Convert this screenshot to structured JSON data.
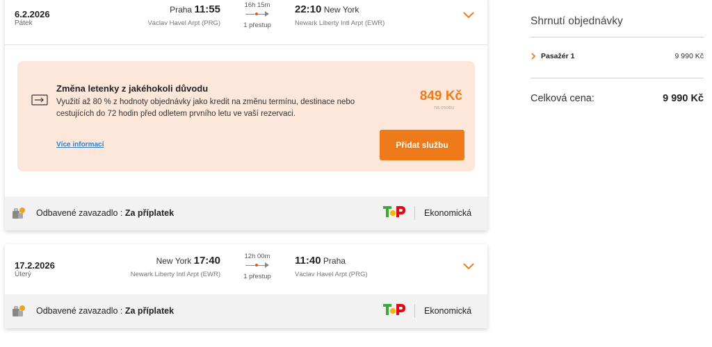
{
  "flights": [
    {
      "date": "6.2.2026",
      "weekday": "Pátek",
      "dep_city": "Praha",
      "dep_time": "11:55",
      "dep_airport": "Václav Havel Arpt (PRG)",
      "duration": "16h 15m",
      "stops": "1 přestup",
      "arr_time": "22:10",
      "arr_city": "New York",
      "arr_airport": "Newark Liberty Intl Arpt (EWR)",
      "baggage_label": "Odbavené zavazadlo :",
      "baggage_value": "Za příplatek",
      "cabin": "Ekonomická"
    },
    {
      "date": "17.2.2026",
      "weekday": "Úterý",
      "dep_city": "New York",
      "dep_time": "17:40",
      "dep_airport": "Newark Liberty Intl Arpt (EWR)",
      "duration": "12h 00m",
      "stops": "1 přestup",
      "arr_time": "11:40",
      "arr_city": "Praha",
      "arr_airport": "Václav Havel Arpt (PRG)",
      "baggage_label": "Odbavené zavazadlo :",
      "baggage_value": "Za příplatek",
      "cabin": "Ekonomická"
    }
  ],
  "offer": {
    "title": "Změna letenky z jakéhokoli důvodu",
    "description": "Využití až 80 % z hodnoty objednávky jako kredit na změnu termínu, destinace nebo cestujících do 72 hodin před odletem prvního letu ve vaší rezervaci.",
    "link": "Více informací",
    "price": "849 Kč",
    "price_note": "na osobu",
    "button": "Přidat službu"
  },
  "summary": {
    "title": "Shrnutí objednávky",
    "passenger_label": "Pasažér 1",
    "passenger_price": "9 990 Kč",
    "total_label": "Celková cena:",
    "total_price": "9 990 Kč"
  },
  "colors": {
    "accent": "#ef7a1a",
    "offer_bg": "#fde7db",
    "link": "#2f7fc1",
    "bar_bg": "#f2f2f2"
  },
  "icons": {
    "expand": "chevron-down-icon",
    "offer": "ticket-change-icon",
    "baggage": "luggage-icon",
    "airline": "tap-airline-logo",
    "passenger": "chevron-right-icon"
  }
}
